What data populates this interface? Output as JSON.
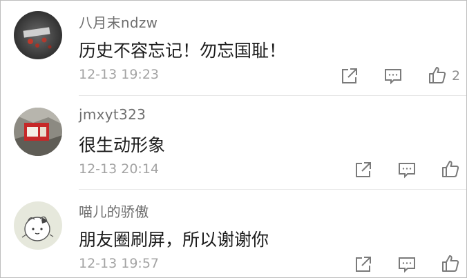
{
  "comments": [
    {
      "username": "八月末ndzw",
      "text": "历史不容忘记！勿忘国耻！",
      "time": "12-13 19:23",
      "likes": "2",
      "avatar_icon": "dark-flower-photo"
    },
    {
      "username": "jmxyt323",
      "text": "很生动形象",
      "time": "12-13 20:14",
      "likes": "",
      "avatar_icon": "rock-poster-photo"
    },
    {
      "username": "喵儿的骄傲",
      "text": "朋友圈刷屏，所以谢谢你",
      "time": "12-13 19:57",
      "likes": "",
      "avatar_icon": "cartoon-character"
    }
  ],
  "colors": {
    "username": "#6e6e6e",
    "text": "#1c1c1c",
    "time": "#a3a3a3",
    "icon": "#7a7a7a",
    "divider": "#e7e7e7"
  }
}
